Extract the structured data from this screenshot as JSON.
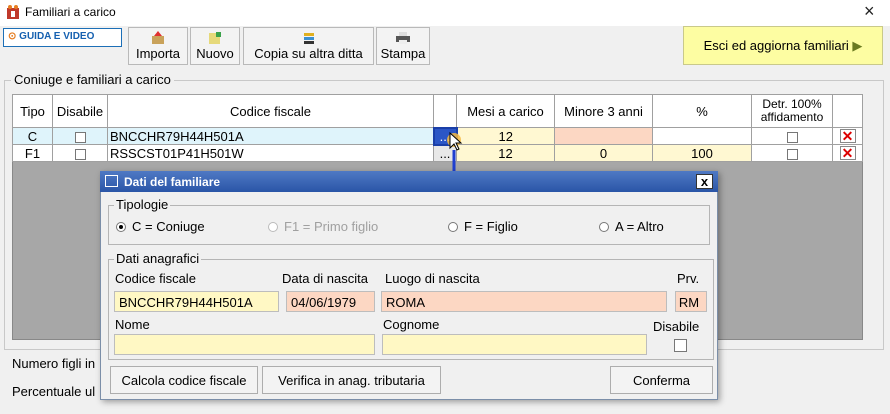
{
  "window": {
    "title": "Familiari a carico",
    "close": "×"
  },
  "toolbar": {
    "guida_label": "GUIDA E VIDEO",
    "buttons": [
      {
        "label": "Importa"
      },
      {
        "label": "Nuovo"
      },
      {
        "label": "Copia su altra ditta"
      },
      {
        "label": "Stampa"
      }
    ],
    "exit_label": "Esci ed aggiorna familiari"
  },
  "group": {
    "label": "Coniuge e familiari a carico"
  },
  "table": {
    "headers": {
      "tipo": "Tipo",
      "disabile": "Disabile",
      "cf": "Codice fiscale",
      "mesi": "Mesi a carico",
      "minore": "Minore 3 anni",
      "pct": "%",
      "detr": "Detr. 100% affidamento"
    },
    "rows": [
      {
        "tipo": "C",
        "cf": "BNCCHR79H44H501A",
        "ellipsis": "...",
        "mesi": "12",
        "minore": "",
        "pct": ""
      },
      {
        "tipo": "F1",
        "cf": "RSSCST01P41H501W",
        "ellipsis": "...",
        "mesi": "12",
        "minore": "0",
        "pct": "100"
      }
    ]
  },
  "below": {
    "numero_figli": "Numero figli in",
    "percentuale": "Percentuale ul"
  },
  "dialog": {
    "title": "Dati del familiare",
    "close": "x",
    "tipologie": {
      "label": "Tipologie",
      "options": [
        "C = Coniuge",
        "F1 = Primo figlio",
        "F = Figlio",
        "A = Altro"
      ],
      "selected": "C = Coniuge"
    },
    "anagrafici": {
      "label": "Dati anagrafici",
      "cf_label": "Codice fiscale",
      "cf_value": "BNCCHR79H44H501A",
      "nascita_label": "Data di nascita",
      "nascita_value": "04/06/1979",
      "luogo_label": "Luogo di nascita",
      "luogo_value": "ROMA",
      "prv_label": "Prv.",
      "prv_value": "RM",
      "nome_label": "Nome",
      "nome_value": "",
      "cognome_label": "Cognome",
      "cognome_value": "",
      "disabile_label": "Disabile"
    },
    "buttons": {
      "calcola": "Calcola codice fiscale",
      "verifica": "Verifica in anag. tributaria",
      "conferma": "Conferma"
    }
  }
}
